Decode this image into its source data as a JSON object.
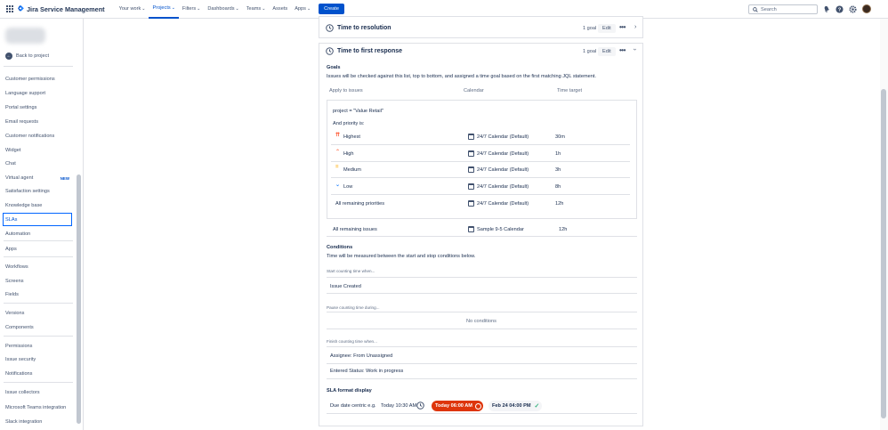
{
  "nav": {
    "product": "Jira Service Management",
    "menu": [
      {
        "label": "Your work"
      },
      {
        "label": "Projects"
      },
      {
        "label": "Filters"
      },
      {
        "label": "Dashboards"
      },
      {
        "label": "Teams"
      },
      {
        "label": "Assets"
      },
      {
        "label": "Apps"
      }
    ],
    "create_label": "Create",
    "search_placeholder": "Search",
    "accent_color": "#0052cc"
  },
  "sidebar": {
    "back_label": "Back to project",
    "items": [
      {
        "label": "Customer permissions"
      },
      {
        "label": "Language support"
      },
      {
        "label": "Portal settings"
      },
      {
        "label": "Email requests"
      },
      {
        "label": "Customer notifications"
      },
      {
        "label": "Widget"
      },
      {
        "label": "Chat"
      },
      {
        "label": "Virtual agent",
        "badge": "NEW"
      },
      {
        "label": "Satisfaction settings"
      },
      {
        "label": "Knowledge base"
      },
      {
        "label": "SLAs"
      },
      {
        "label": "Automation"
      },
      {
        "label": "Apps"
      },
      {
        "label": "Workflows"
      },
      {
        "label": "Screens"
      },
      {
        "label": "Fields"
      },
      {
        "label": "Versions"
      },
      {
        "label": "Components"
      },
      {
        "label": "Permissions"
      },
      {
        "label": "Issue security"
      },
      {
        "label": "Notifications"
      },
      {
        "label": "Issue collectors"
      },
      {
        "label": "Microsoft Teams integration"
      },
      {
        "label": "Slack integration"
      }
    ]
  },
  "sla_resolution": {
    "title": "Time to resolution",
    "goal_count": "1 goal",
    "edit_label": "Edit"
  },
  "sla_first_response": {
    "title": "Time to first response",
    "goal_count": "1 goal",
    "edit_label": "Edit",
    "goals_heading": "Goals",
    "goals_desc": "Issues will be checked against this list, top to bottom, and assigned a time goal based on the first matching JQL statement.",
    "col_apply": "Apply to issues",
    "col_calendar": "Calendar",
    "col_target": "Time target",
    "jql": "project = \"Value Retail\"",
    "and_priority": "And priority is:",
    "priorities": [
      {
        "name": "Highest",
        "calendar": "24/7 Calendar (Default)",
        "target": "30m",
        "color": "#ff5630",
        "glyph": "⇈"
      },
      {
        "name": "High",
        "calendar": "24/7 Calendar (Default)",
        "target": "1h",
        "color": "#ff7452",
        "glyph": "⌃"
      },
      {
        "name": "Medium",
        "calendar": "24/7 Calendar (Default)",
        "target": "3h",
        "color": "#ffab00",
        "glyph": "="
      },
      {
        "name": "Low",
        "calendar": "24/7 Calendar (Default)",
        "target": "8h",
        "color": "#2684ff",
        "glyph": "⌄"
      }
    ],
    "remaining_priorities": {
      "name": "All remaining priorities",
      "calendar": "24/7 Calendar (Default)",
      "target": "12h"
    },
    "remaining_issues": {
      "name": "All remaining issues",
      "calendar": "Sample 9-5 Calendar",
      "target": "12h"
    },
    "conditions_heading": "Conditions",
    "conditions_desc": "Time will be measured between the start and stop conditions below.",
    "start_label": "Start counting time when...",
    "start_value": "Issue Created",
    "pause_label": "Pause counting time during...",
    "pause_value": "No conditions",
    "finish_label": "Finish counting time when...",
    "finish_values": [
      "Assignee: From Unassigned",
      "Entered Status: Work in progress"
    ],
    "format_heading": "SLA format display",
    "format_label": "Due date centric e.g.",
    "format_example_1": "Today 10:30 AM",
    "format_example_2": "Today 06:00 AM",
    "format_example_3": "Feb 24 04:00 PM"
  }
}
